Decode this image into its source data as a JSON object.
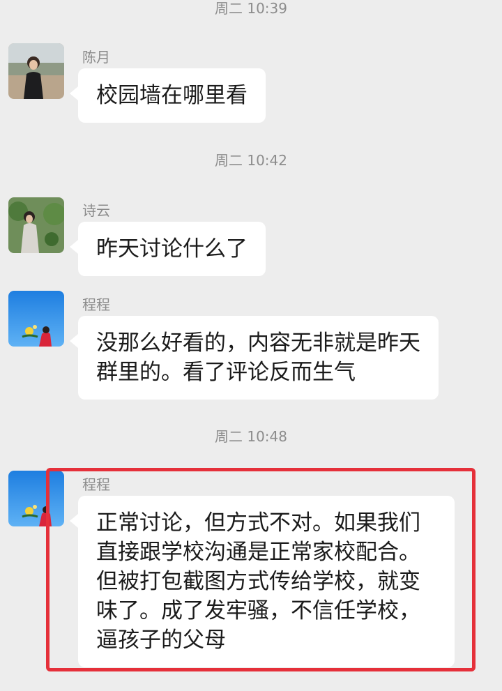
{
  "timestamps": [
    "周二 10:39",
    "周二 10:42",
    "周二 10:48"
  ],
  "messages": [
    {
      "sender": "陈月",
      "text": "校园墙在哪里看"
    },
    {
      "sender": "诗云",
      "text": "昨天讨论什么了"
    },
    {
      "sender": "程程",
      "lines": [
        "没那么好看的，内容无非就是昨天",
        "群里的。看了评论反而生气"
      ]
    },
    {
      "sender": "程程",
      "lines": [
        "正常讨论，但方式不对。如果我们",
        "直接跟学校沟通是正常家校配合。",
        "但被打包截图方式传给学校，就变",
        "味了。成了发牢骚，不信任学校，",
        "逼孩子的父母"
      ]
    }
  ],
  "colors": {
    "highlight_border": "#e5303a",
    "background": "#ededed",
    "bubble": "#ffffff"
  }
}
